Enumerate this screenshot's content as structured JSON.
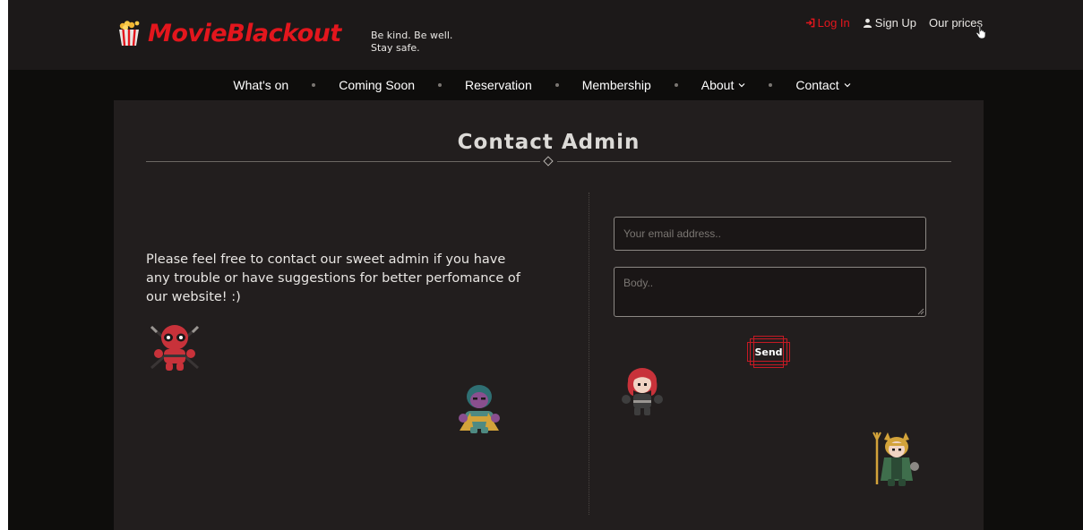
{
  "brand": {
    "name": "MovieBlackout",
    "color": "#e3161d",
    "logo_icon": "popcorn-icon"
  },
  "tagline": {
    "line1": "Be kind. Be well.",
    "line2": "Stay safe."
  },
  "topnav": {
    "login": "Log In",
    "signup": "Sign Up",
    "prices": "Our prices"
  },
  "mainnav": {
    "items": [
      {
        "label": "What's on"
      },
      {
        "label": "Coming Soon"
      },
      {
        "label": "Reservation"
      },
      {
        "label": "Membership"
      },
      {
        "label": "About"
      },
      {
        "label": "Contact"
      }
    ]
  },
  "page": {
    "title": "Contact Admin",
    "intro": "Please feel free to contact our sweet admin if you have any trouble or have suggestions for better perfomance of our website! :)"
  },
  "form": {
    "email_placeholder": "Your email address..",
    "body_placeholder": "Body..",
    "send_label": "Send"
  },
  "characters": [
    {
      "name": "deadpool-chibi"
    },
    {
      "name": "thanos-chibi"
    },
    {
      "name": "black-widow-chibi"
    },
    {
      "name": "loki-chibi"
    }
  ],
  "colors": {
    "accent": "#e3161d",
    "panel": "#221e1e",
    "header": "#1c1919",
    "background": "#0e0d0c"
  }
}
